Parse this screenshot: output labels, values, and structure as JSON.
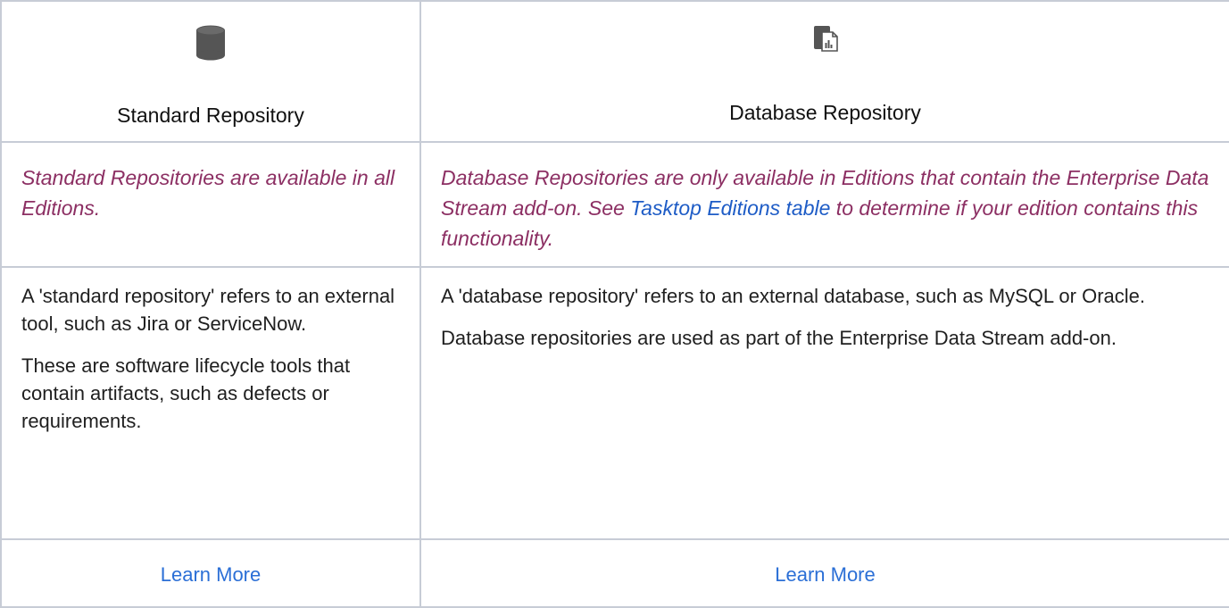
{
  "columns": [
    {
      "icon": "database-cylinder-icon",
      "title": "Standard Repository",
      "availability": {
        "before": "Standard Repositories are available in all Editions.",
        "link": "",
        "after": ""
      },
      "description": [
        "A 'standard repository' refers to an external tool, such as Jira or ServiceNow.",
        "These are software lifecycle tools that contain artifacts, such as defects or requirements."
      ],
      "learn_more": "Learn More"
    },
    {
      "icon": "database-report-icon",
      "title": "Database Repository",
      "availability": {
        "before": "Database Repositories are only available in Editions that contain the Enterprise Data Stream add-on.  See ",
        "link": "Tasktop Editions table",
        "after": " to determine if your edition contains this functionality."
      },
      "description": [
        "A 'database repository' refers to an external database, such as MySQL or Oracle.",
        "Database repositories are used as part of the Enterprise Data Stream add-on."
      ],
      "learn_more": "Learn More"
    }
  ],
  "colors": {
    "availability_text": "#8c2f63",
    "link": "#2b6fd6",
    "border": "#c7ccd6",
    "icon": "#555555"
  }
}
